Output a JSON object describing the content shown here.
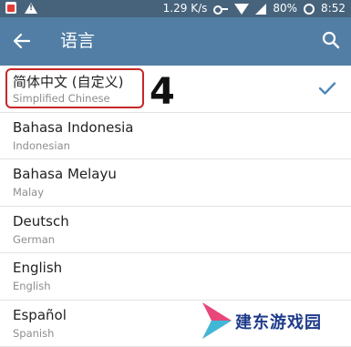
{
  "status_bar": {
    "net_speed": "1.29 K/s",
    "battery_percent": "80%",
    "time": "8:52",
    "icons": [
      "notification-red-icon",
      "warning-icon",
      "vpn-key-icon",
      "wifi-icon",
      "signal-icon",
      "battery-icon"
    ]
  },
  "app_bar": {
    "title": "语言",
    "back_icon": "arrow-left",
    "search_icon": "magnifier"
  },
  "languages": [
    {
      "name": "简体中文 (自定义)",
      "native": "Simplified Chinese",
      "selected": true
    },
    {
      "name": "Bahasa Indonesia",
      "native": "Indonesian",
      "selected": false
    },
    {
      "name": "Bahasa Melayu",
      "native": "Malay",
      "selected": false
    },
    {
      "name": "Deutsch",
      "native": "German",
      "selected": false
    },
    {
      "name": "English",
      "native": "English",
      "selected": false
    },
    {
      "name": "Español",
      "native": "Spanish",
      "selected": false
    }
  ],
  "annotation": {
    "step_number": "4",
    "highlight_color": "#c62828"
  },
  "watermark": {
    "text": "建东游戏园"
  },
  "colors": {
    "status_bar": "#47637c",
    "app_bar": "#527ea5",
    "check_mark": "#4f86b8"
  }
}
